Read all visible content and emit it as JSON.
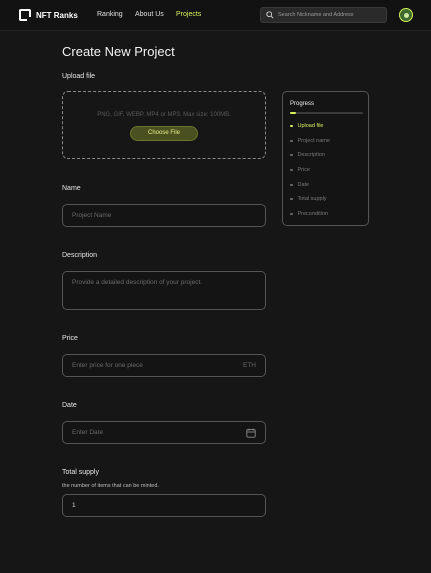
{
  "header": {
    "brand": "NFT Ranks",
    "nav": [
      {
        "label": "Ranking",
        "active": false
      },
      {
        "label": "About Us",
        "active": false
      },
      {
        "label": "Projects",
        "active": true
      }
    ],
    "search_placeholder": "Search Nickname and Address"
  },
  "page": {
    "title": "Create New Project"
  },
  "upload": {
    "label": "Upload  file",
    "hint": "PNG, GIF, WEBP, MP4 or MP3. Max size: 100MB.",
    "button": "Choose File"
  },
  "name": {
    "label": "Name",
    "placeholder": "Project Name"
  },
  "description": {
    "label": "Description",
    "placeholder": "Provide a detailed description of your project."
  },
  "price": {
    "label": "Price",
    "placeholder": "Enter price for one piece",
    "suffix": "ETH"
  },
  "date": {
    "label": "Date",
    "placeholder": "Enter Date"
  },
  "total_supply": {
    "label": "Total supply",
    "sublabel": "the number of items that can be minted.",
    "value": "1"
  },
  "progress": {
    "title": "Progress",
    "fraction": 0.08,
    "steps": [
      {
        "label": "Upload file",
        "active": true
      },
      {
        "label": "Project name",
        "active": false
      },
      {
        "label": "Description",
        "active": false
      },
      {
        "label": "Price",
        "active": false
      },
      {
        "label": "Date",
        "active": false
      },
      {
        "label": "Total supply",
        "active": false
      },
      {
        "label": "Precondition",
        "active": false
      }
    ]
  },
  "colors": {
    "accent": "#d7ef5b",
    "background": "#161616"
  }
}
